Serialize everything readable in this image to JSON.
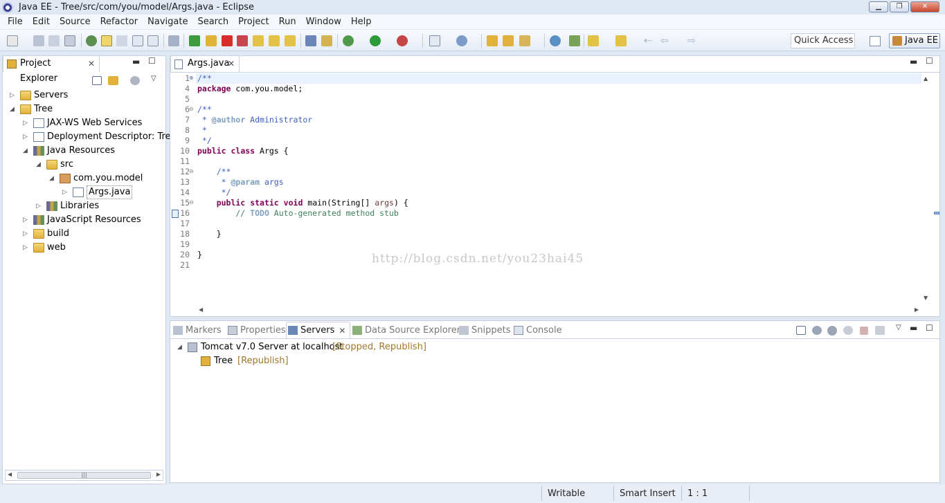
{
  "window": {
    "title": "Java EE - Tree/src/com/you/model/Args.java - Eclipse"
  },
  "menu": [
    "File",
    "Edit",
    "Source",
    "Refactor",
    "Navigate",
    "Search",
    "Project",
    "Run",
    "Window",
    "Help"
  ],
  "toolbar": {
    "quick_access": "Quick Access",
    "perspective": "Java EE"
  },
  "explorer": {
    "tab": "Project Explorer",
    "items": [
      {
        "label": "Servers",
        "level": 0,
        "arrow": "closed",
        "icon": "folder"
      },
      {
        "label": "Tree",
        "level": 0,
        "arrow": "open",
        "icon": "project"
      },
      {
        "label": "JAX-WS Web Services",
        "level": 1,
        "arrow": "closed",
        "icon": "webservice"
      },
      {
        "label": "Deployment Descriptor: Tree",
        "level": 1,
        "arrow": "closed",
        "icon": "descriptor"
      },
      {
        "label": "Java Resources",
        "level": 1,
        "arrow": "open",
        "icon": "javares"
      },
      {
        "label": "src",
        "level": 2,
        "arrow": "open",
        "icon": "srcfolder"
      },
      {
        "label": "com.you.model",
        "level": 3,
        "arrow": "open",
        "icon": "package"
      },
      {
        "label": "Args.java",
        "level": 4,
        "arrow": "closed",
        "icon": "javafile"
      },
      {
        "label": "Libraries",
        "level": 2,
        "arrow": "closed",
        "icon": "library"
      },
      {
        "label": "JavaScript Resources",
        "level": 1,
        "arrow": "closed",
        "icon": "jsres"
      },
      {
        "label": "build",
        "level": 1,
        "arrow": "closed",
        "icon": "folder"
      },
      {
        "label": "web",
        "level": 1,
        "arrow": "closed",
        "icon": "folder"
      }
    ]
  },
  "editor": {
    "tab": "Args.java",
    "line_numbers": [
      "1",
      "4",
      "5",
      "6",
      "7",
      "8",
      "9",
      "10",
      "11",
      "12",
      "13",
      "14",
      "15",
      "16",
      "17",
      "18",
      "19",
      "20",
      "21"
    ],
    "watermark": "http://blog.csdn.net/you23hai45",
    "code": {
      "l1": "/**",
      "l4a": "package",
      "l4b": " com.you.model;",
      "l6": "/**",
      "l7a": " * ",
      "l7b": "@author",
      "l7c": " Administrator",
      "l8": " *",
      "l9": " */",
      "l10a": "public",
      "l10b": " ",
      "l10c": "class",
      "l10d": " Args {",
      "l12": "    /**",
      "l13a": "     * ",
      "l13b": "@param",
      "l13c": " args",
      "l14": "     */",
      "l15a": "    public",
      "l15b": " ",
      "l15c": "static",
      "l15d": " ",
      "l15e": "void",
      "l15f": " main(String[] ",
      "l15g": "args",
      "l15h": ") {",
      "l16a": "        // ",
      "l16b": "TODO",
      "l16c": " Auto-generated method stub",
      "l18": "    }",
      "l20": "}"
    }
  },
  "bottom": {
    "tabs": [
      "Markers",
      "Properties",
      "Servers",
      "Data Source Explorer",
      "Snippets",
      "Console"
    ],
    "active_tab": "Servers",
    "server": {
      "name": "Tomcat v7.0 Server at localhost",
      "state": "[Stopped, Republish]"
    },
    "module": {
      "name": "Tree",
      "state": "[Republish]"
    }
  },
  "status": {
    "writable": "Writable",
    "insert_mode": "Smart Insert",
    "position": "1 : 1"
  },
  "colors": {
    "keyword": "#7f0055",
    "javadoc": "#3f5fbf",
    "comment": "#3f7f5f",
    "status_text": "#a0782a"
  }
}
